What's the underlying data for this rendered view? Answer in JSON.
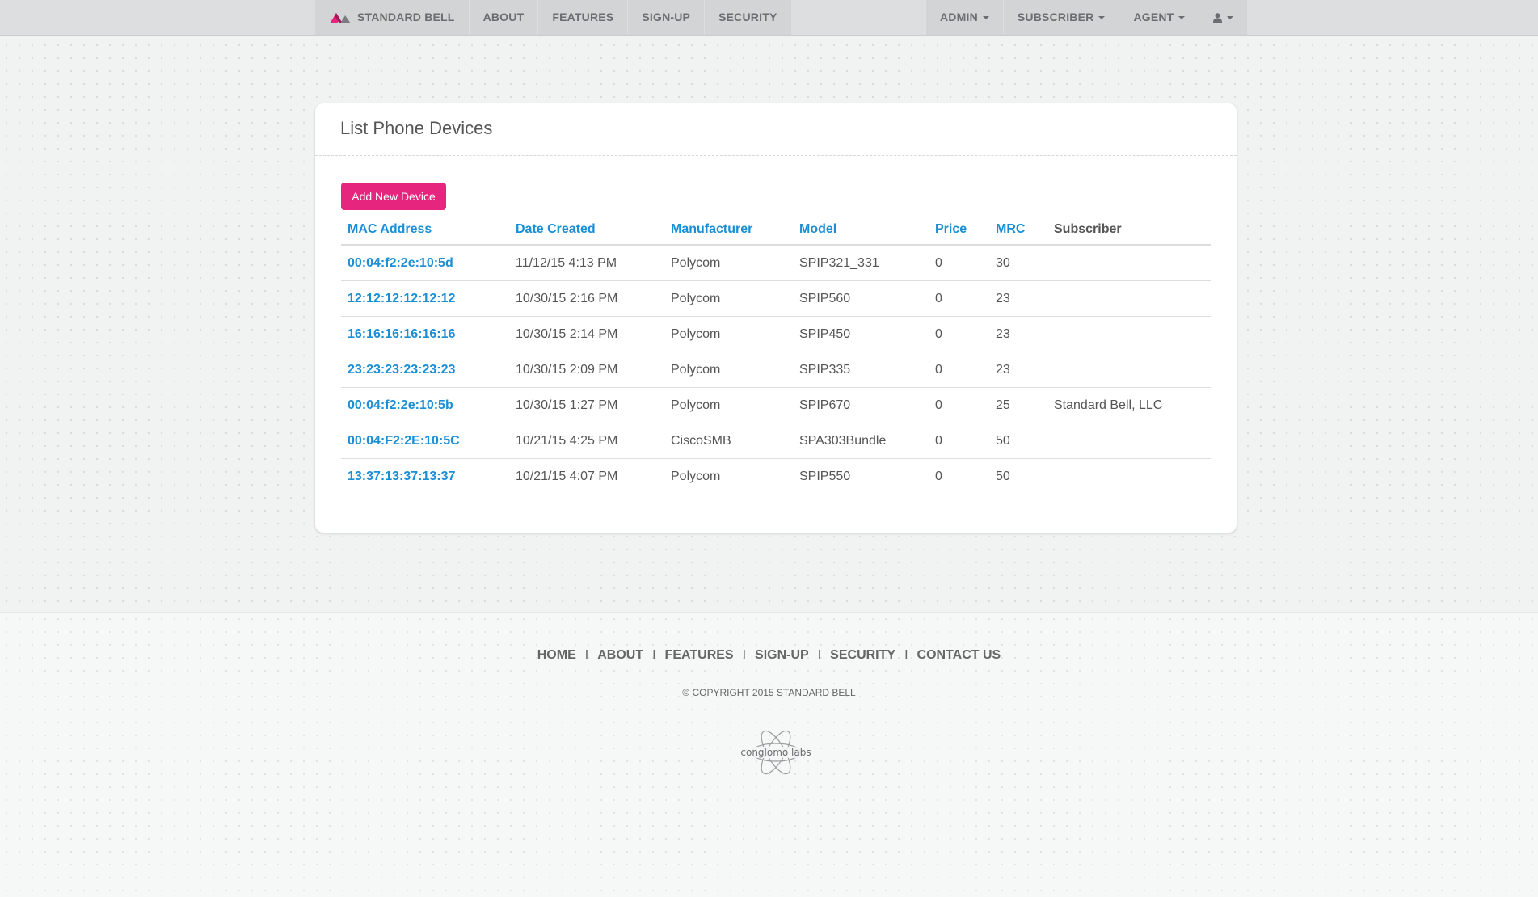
{
  "nav": {
    "brand": "STANDARD BELL",
    "left_items": [
      "ABOUT",
      "FEATURES",
      "SIGN-UP",
      "SECURITY"
    ],
    "right_items": [
      "ADMIN",
      "SUBSCRIBER",
      "AGENT"
    ]
  },
  "panel": {
    "title": "List Phone Devices",
    "add_button": "Add New Device"
  },
  "table": {
    "headers": [
      "MAC Address",
      "Date Created",
      "Manufacturer",
      "Model",
      "Price",
      "MRC",
      "Subscriber"
    ],
    "rows": [
      {
        "mac": "00:04:f2:2e:10:5d",
        "date": "11/12/15 4:13 PM",
        "manufacturer": "Polycom",
        "model": "SPIP321_331",
        "price": "0",
        "mrc": "30",
        "subscriber": ""
      },
      {
        "mac": "12:12:12:12:12:12",
        "date": "10/30/15 2:16 PM",
        "manufacturer": "Polycom",
        "model": "SPIP560",
        "price": "0",
        "mrc": "23",
        "subscriber": ""
      },
      {
        "mac": "16:16:16:16:16:16",
        "date": "10/30/15 2:14 PM",
        "manufacturer": "Polycom",
        "model": "SPIP450",
        "price": "0",
        "mrc": "23",
        "subscriber": ""
      },
      {
        "mac": "23:23:23:23:23:23",
        "date": "10/30/15 2:09 PM",
        "manufacturer": "Polycom",
        "model": "SPIP335",
        "price": "0",
        "mrc": "23",
        "subscriber": ""
      },
      {
        "mac": "00:04:f2:2e:10:5b",
        "date": "10/30/15 1:27 PM",
        "manufacturer": "Polycom",
        "model": "SPIP670",
        "price": "0",
        "mrc": "25",
        "subscriber": "Standard Bell, LLC"
      },
      {
        "mac": "00:04:F2:2E:10:5C",
        "date": "10/21/15 4:25 PM",
        "manufacturer": "CiscoSMB",
        "model": "SPA303Bundle",
        "price": "0",
        "mrc": "50",
        "subscriber": ""
      },
      {
        "mac": "13:37:13:37:13:37",
        "date": "10/21/15 4:07 PM",
        "manufacturer": "Polycom",
        "model": "SPIP550",
        "price": "0",
        "mrc": "50",
        "subscriber": ""
      }
    ]
  },
  "footer": {
    "links": [
      "HOME",
      "ABOUT",
      "FEATURES",
      "SIGN-UP",
      "SECURITY",
      "CONTACT US"
    ],
    "separator": "I",
    "copyright": "© COPYRIGHT 2015 STANDARD BELL",
    "logo_text": "conglomo labs"
  },
  "colors": {
    "accent": "#e6267e",
    "link": "#1a8fd6"
  },
  "icons": {
    "brand": "standard-bell-logo-icon",
    "user": "user-icon",
    "caret": "caret-down-icon"
  }
}
